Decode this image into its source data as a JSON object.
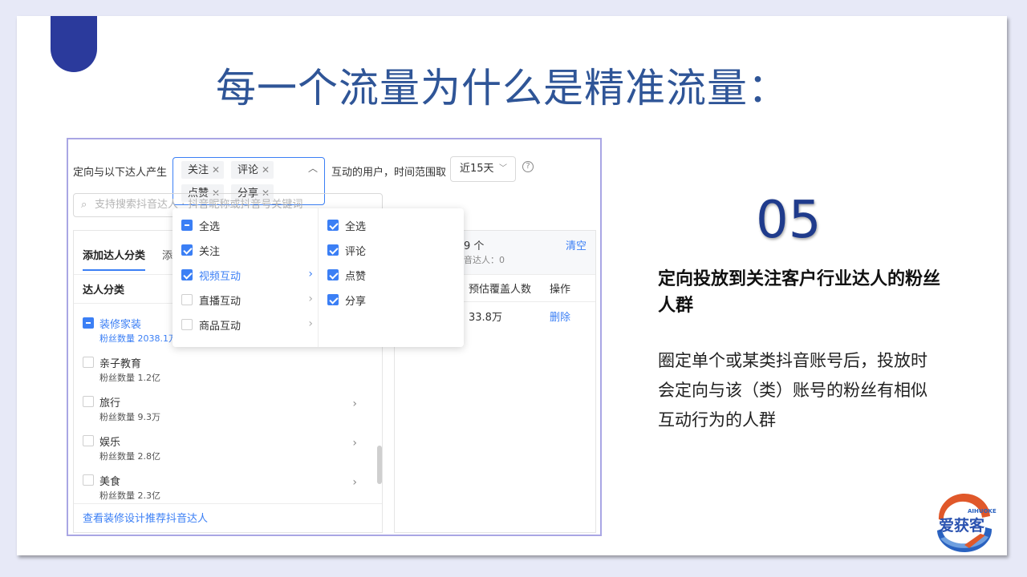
{
  "slide": {
    "title": "每一个流量为什么是精准流量：",
    "number": "05",
    "heading": "定向投放到关注客户行业达人的粉丝人群",
    "description": "圈定单个或某类抖音账号后，投放时会定向与该（类）账号的粉丝有相似互动行为的人群",
    "logo": {
      "en": "AIHUOKE",
      "cn": "爱获客"
    }
  },
  "filter": {
    "prefix": "定向与以下达人产生",
    "tags": [
      "关注",
      "评论",
      "点赞",
      "分享"
    ],
    "tag_remove_glyph": "✕",
    "middle": "互动的用户，时间范围取",
    "time_range": "近15天",
    "help_glyph": "?"
  },
  "search": {
    "placeholder": "支持搜索抖音达人 · 抖音昵称或抖音号关键词"
  },
  "dropdown": {
    "left": [
      {
        "label": "全选",
        "state": "partial",
        "has_arrow": false
      },
      {
        "label": "关注",
        "state": "checked",
        "has_arrow": false
      },
      {
        "label": "视频互动",
        "state": "checked",
        "has_arrow": true,
        "highlighted": true
      },
      {
        "label": "直播互动",
        "state": "unchecked",
        "has_arrow": true
      },
      {
        "label": "商品互动",
        "state": "unchecked",
        "has_arrow": true
      }
    ],
    "right": [
      {
        "label": "全选",
        "state": "checked"
      },
      {
        "label": "评论",
        "state": "checked"
      },
      {
        "label": "点赞",
        "state": "checked"
      },
      {
        "label": "分享",
        "state": "checked"
      }
    ]
  },
  "left_panel": {
    "tab_active": "添加达人分类",
    "tab_inactive": "添",
    "sub_header": "达人分类",
    "categories": [
      {
        "name": "装修家装",
        "fans": "粉丝数量 2038.1万",
        "state": "partial",
        "selected": true,
        "has_arrow": false
      },
      {
        "name": "亲子教育",
        "fans": "粉丝数量 1.2亿",
        "state": "unchecked",
        "selected": false,
        "has_arrow": false
      },
      {
        "name": "旅行",
        "fans": "粉丝数量 9.3万",
        "state": "unchecked",
        "selected": false,
        "has_arrow": true
      },
      {
        "name": "娱乐",
        "fans": "粉丝数量 2.8亿",
        "state": "unchecked",
        "selected": false,
        "has_arrow": true
      },
      {
        "name": "美食",
        "fans": "粉丝数量 2.3亿",
        "state": "unchecked",
        "selected": false,
        "has_arrow": true
      }
    ],
    "footer_link": "查看装修设计推荐抖音达人"
  },
  "right_panel": {
    "count": "9 个",
    "count_sub": "音达人：0",
    "clear": "清空",
    "col_coverage": "预估覆盖人数",
    "col_action": "操作",
    "row_value": "33.8万",
    "row_action": "删除"
  }
}
